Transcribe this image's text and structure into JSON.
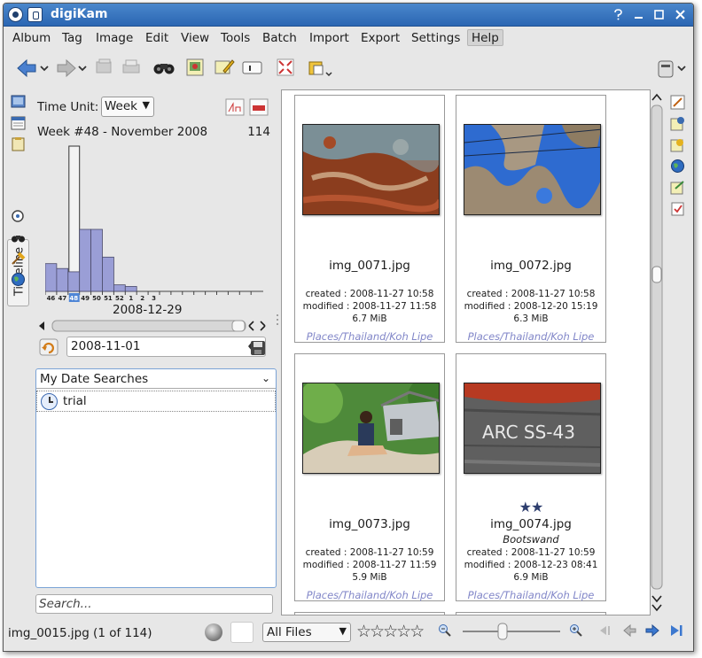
{
  "window": {
    "title": "digiKam"
  },
  "menu": [
    "Album",
    "Tag",
    "Image",
    "Edit",
    "View",
    "Tools",
    "Batch",
    "Import",
    "Export",
    "Settings",
    "Help"
  ],
  "toolbar": {
    "logo_text": "digiKam"
  },
  "sidebar_tabs": {
    "timeline": "Timeline"
  },
  "timeline": {
    "time_unit_label": "Time Unit:",
    "time_unit_value": "Week",
    "week_label": "Week #48 - November 2008",
    "count": "114",
    "weeks": [
      "46",
      "47",
      "48",
      "49",
      "50",
      "51",
      "52",
      "1",
      "2",
      "3",
      "",
      "",
      "",
      "",
      "",
      "",
      "",
      "",
      ""
    ],
    "bar_values": [
      17,
      14,
      12,
      38,
      38,
      21,
      4,
      3,
      0,
      0,
      0,
      0,
      0,
      0,
      0,
      0,
      0,
      0,
      0
    ],
    "selected_week": "48",
    "cursor_date": "2008-12-29",
    "date_value": "2008-11-01"
  },
  "date_searches": {
    "header": "My Date Searches",
    "items": [
      {
        "label": "trial"
      }
    ]
  },
  "search": {
    "placeholder": "Search..."
  },
  "images": [
    {
      "name": "img_0071.jpg",
      "stars": "",
      "caption": "",
      "created": "created : 2008-11-27 10:58",
      "modified": "modified : 2008-11-27 11:58",
      "size": "6.7 MiB",
      "album": "Places/Thailand/Koh Lipe"
    },
    {
      "name": "img_0072.jpg",
      "stars": "",
      "caption": "",
      "created": "created : 2008-11-27 10:58",
      "modified": "modified : 2008-12-20 15:19",
      "size": "6.3 MiB",
      "album": "Places/Thailand/Koh Lipe"
    },
    {
      "name": "img_0073.jpg",
      "stars": "",
      "caption": "",
      "created": "created : 2008-11-27 10:59",
      "modified": "modified : 2008-11-27 11:59",
      "size": "5.9 MiB",
      "album": "Places/Thailand/Koh Lipe"
    },
    {
      "name": "img_0074.jpg",
      "stars": "★★",
      "caption": "Bootswand",
      "created": "created : 2008-11-27 10:59",
      "modified": "modified : 2008-12-23 08:41",
      "size": "6.9 MiB",
      "album": "Places/Thailand/Koh Lipe",
      "thumb_text": "ARC SS-43"
    }
  ],
  "status": {
    "text": "img_0015.jpg (1 of 114)",
    "filter": "All Files",
    "rating": "☆☆☆☆☆"
  },
  "colors": {
    "titlebar": "#2b66b3",
    "histogram_bar": "#9a9ed6",
    "histogram_selected": "#4f86d6",
    "album_link": "#8186c8"
  }
}
